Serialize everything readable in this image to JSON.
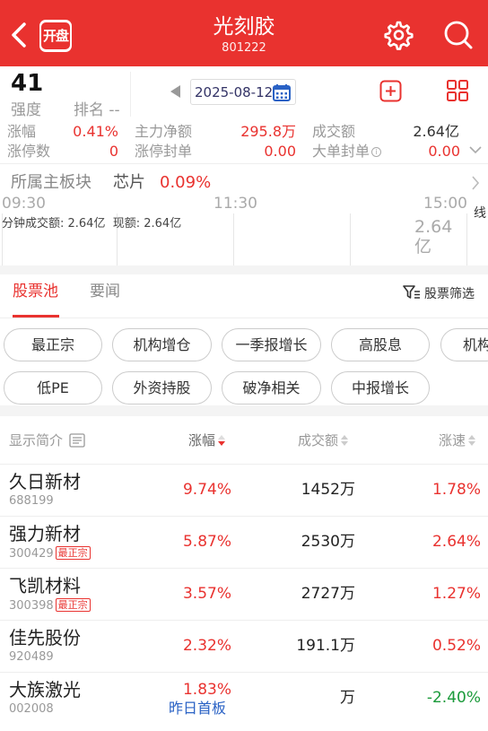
{
  "header": {
    "title": "光刻胶",
    "code": "801222",
    "logo_text": "开盘",
    "bg_color": "#e9322f"
  },
  "summary": {
    "strength_value": "41",
    "strength_label": "强度",
    "rank_label": "排名 --",
    "date": "2025-08-12"
  },
  "stats": [
    {
      "label": "涨幅",
      "value": "0.41%",
      "color": "#e9322f"
    },
    {
      "label": "主力净额",
      "value": "295.8万",
      "color": "#e9322f"
    },
    {
      "label": "成交额",
      "value": "2.64亿",
      "color": "#333333"
    },
    {
      "label": "涨停数",
      "value": "0",
      "color": "#e9322f"
    },
    {
      "label": "涨停封单",
      "value": "0.00",
      "color": "#e9322f"
    },
    {
      "label": "大单封单",
      "value": "0.00",
      "color": "#e9322f"
    }
  ],
  "sector": {
    "label": "所属主板块",
    "name": "芯片",
    "pct": "0.09%"
  },
  "chart": {
    "time_start": "09:30",
    "time_mid": "11:30",
    "time_end": "15:00",
    "minute_turnover": "分钟成交额: 2.64亿",
    "current_amount": "现额: 2.64亿",
    "right_value": "2.64亿",
    "side_label": "线"
  },
  "tabs": {
    "active": "股票池",
    "news": "要闻",
    "filter": "股票筛选"
  },
  "chips": [
    "最正宗",
    "机构增仓",
    "一季报增长",
    "高股息",
    "机构",
    "低PE",
    "外资持股",
    "破净相关",
    "中报增长"
  ],
  "list_header": {
    "col1": "显示简介",
    "col2": "涨幅",
    "col3": "成交额",
    "col4": "涨速"
  },
  "rows": [
    {
      "name": "久日新材",
      "code": "688199",
      "badge": "",
      "pct": "9.74%",
      "vol": "1452万",
      "speed": "1.78%",
      "note": ""
    },
    {
      "name": "强力新材",
      "code": "300429",
      "badge": "最正宗",
      "pct": "5.87%",
      "vol": "2530万",
      "speed": "2.64%",
      "note": ""
    },
    {
      "name": "飞凯材料",
      "code": "300398",
      "badge": "最正宗",
      "pct": "3.57%",
      "vol": "2727万",
      "speed": "1.27%",
      "note": ""
    },
    {
      "name": "佳先股份",
      "code": "920489",
      "badge": "",
      "pct": "2.32%",
      "vol": "191.1万",
      "speed": "0.52%",
      "note": ""
    },
    {
      "name": "大族激光",
      "code": "002008",
      "badge": "",
      "pct": "1.83%",
      "vol": "万",
      "speed": "-2.40%",
      "note": "昨日首板"
    }
  ]
}
